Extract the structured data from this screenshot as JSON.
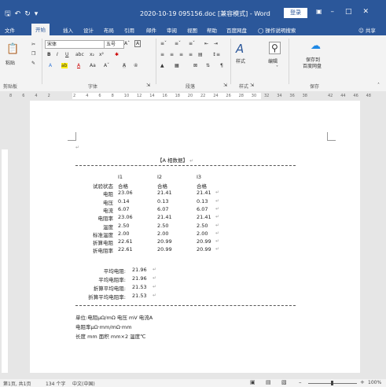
{
  "window": {
    "qat_icons": [
      "save-icon",
      "undo-icon",
      "redo-icon",
      "customize-icon"
    ],
    "title": "2020-10-19 095156.doc [兼容模式] - Word",
    "login_label": "登录",
    "controls": [
      "minimize-icon",
      "maximize-icon",
      "close-icon"
    ]
  },
  "tabs": [
    {
      "label": "文件"
    },
    {
      "label": "开始"
    },
    {
      "label": "插入"
    },
    {
      "label": "设计"
    },
    {
      "label": "布局"
    },
    {
      "label": "引用"
    },
    {
      "label": "邮件"
    },
    {
      "label": "审阅"
    },
    {
      "label": "视图"
    },
    {
      "label": "帮助"
    },
    {
      "label": "百度网盘"
    }
  ],
  "active_tab": "开始",
  "tell_me": "操作说明搜索",
  "share": "共享",
  "ribbon": {
    "paste": "粘贴",
    "clipboard": "剪贴板",
    "font_name": "宋体",
    "font_size": "五号",
    "bold": "B",
    "italic": "I",
    "underline": "U",
    "font_group": "字体",
    "paragraph_group": "段落",
    "styles": "样式",
    "styles_group": "样式",
    "editing": "编辑",
    "save_baidu": "保存到",
    "save_baidu2": "百度网盘",
    "save_group": "保存"
  },
  "ruler": [
    "8",
    "6",
    "4",
    "2",
    "",
    "2",
    "4",
    "6",
    "8",
    "10",
    "12",
    "14",
    "16",
    "18",
    "20",
    "22",
    "24",
    "26",
    "28",
    "30",
    "32",
    "34",
    "36",
    "38",
    "",
    "42",
    "44",
    "46",
    "48"
  ],
  "document": {
    "title": "【A 相数据】",
    "headers": [
      "I1",
      "I2",
      "I3"
    ],
    "rows": [
      {
        "label": "试验状态",
        "v1": "合格",
        "v2": "合格",
        "v3": "合格"
      },
      {
        "label": "电阻",
        "v1": "23.06",
        "v2": "21.41",
        "v3": "21.41"
      },
      {
        "label": "电压",
        "v1": "0.14",
        "v2": "0.13",
        "v3": "0.13"
      },
      {
        "label": "电流",
        "v1": "6.07",
        "v2": "6.07",
        "v3": "6.07"
      },
      {
        "label": "电阻率",
        "v1": "23.06",
        "v2": "21.41",
        "v3": "21.41"
      },
      {
        "label": "温度",
        "v1": "2.50",
        "v2": "2.50",
        "v3": "2.50"
      },
      {
        "label": "标准温度",
        "v1": "2.00",
        "v2": "2.00",
        "v3": "2.00"
      },
      {
        "label": "折算电阻",
        "v1": "22.61",
        "v2": "20.99",
        "v3": "20.99"
      },
      {
        "label": "折电阻率",
        "v1": "22.61",
        "v2": "20.99",
        "v3": "20.99"
      }
    ],
    "averages": [
      {
        "label": "平均电阻:",
        "value": "21.96"
      },
      {
        "label": "平均电阻率:",
        "value": "21.96"
      },
      {
        "label": "折算平均电阻:",
        "value": "21.53"
      },
      {
        "label": "折算平均电阻率:",
        "value": "21.53"
      }
    ],
    "notes": [
      "单位:电阻μΩ/mΩ 电压 mV 电流A",
      "电阻率μΩ·mm/mΩ·mm",
      "长度 mm 面积 mm×2 温度℃"
    ]
  },
  "status": {
    "page": "第1页, 共1页",
    "words": "134 个字",
    "language": "中文(中国)",
    "zoom": "100%"
  }
}
